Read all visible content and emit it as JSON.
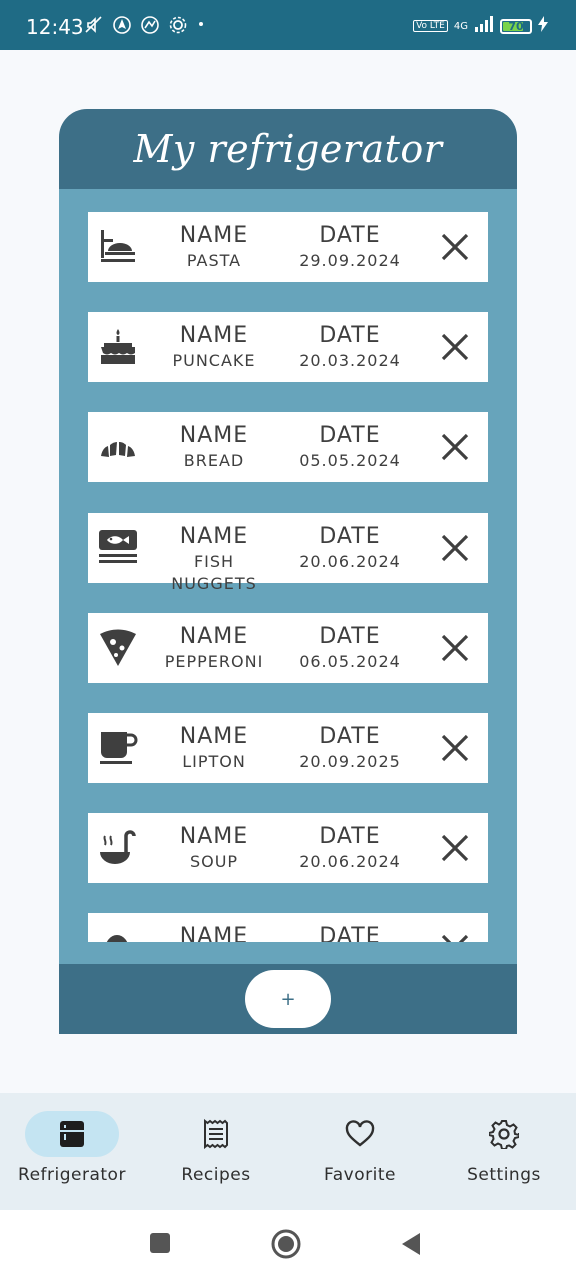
{
  "status_bar": {
    "time": "12:43",
    "network": "4G",
    "volte": "Vo LTE",
    "battery": "70"
  },
  "card": {
    "title": "My refrigerator",
    "col_name_header": "NAME",
    "col_date_header": "DATE",
    "items": [
      {
        "icon": "pasta-icon",
        "name": "PASTA",
        "date": "29.09.2024"
      },
      {
        "icon": "cake-icon",
        "name": "PUNCAKE",
        "date": "20.03.2024"
      },
      {
        "icon": "croissant-icon",
        "name": "BREAD",
        "date": "05.05.2024"
      },
      {
        "icon": "fish-icon",
        "name": "FISH NUGGETS",
        "date": "20.06.2024"
      },
      {
        "icon": "pizza-icon",
        "name": "PEPPERONI",
        "date": "06.05.2024"
      },
      {
        "icon": "cup-icon",
        "name": "LIPTON",
        "date": "20.09.2025"
      },
      {
        "icon": "ladle-icon",
        "name": "SOUP",
        "date": "20.06.2024"
      },
      {
        "icon": "egg-icon",
        "name": "NAME",
        "date": "DATE"
      }
    ],
    "add_label": "+"
  },
  "bottom_nav": {
    "items": [
      {
        "label": "Refrigerator",
        "icon": "fridge-icon",
        "active": true
      },
      {
        "label": "Recipes",
        "icon": "receipt-icon",
        "active": false
      },
      {
        "label": "Favorite",
        "icon": "heart-icon",
        "active": false
      },
      {
        "label": "Settings",
        "icon": "gear-icon",
        "active": false
      }
    ]
  },
  "system_nav": [
    "recents-button",
    "home-button",
    "back-button"
  ],
  "colors": {
    "status_bar": "#1f6b85",
    "card_header": "#3d6f87",
    "card_body": "#67a4bb",
    "nav_bg": "#e6eef3",
    "nav_active": "#c4e4f2"
  }
}
